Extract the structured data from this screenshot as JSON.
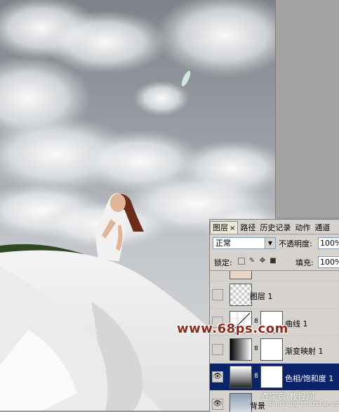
{
  "layers_panel": {
    "tabs": [
      {
        "label": "图层",
        "active": true
      },
      {
        "label": "路径",
        "active": false
      },
      {
        "label": "历史记录",
        "active": false
      },
      {
        "label": "动作",
        "active": false
      },
      {
        "label": "通道",
        "active": false
      }
    ],
    "blend_mode": "正常",
    "opacity_label": "不透明度:",
    "opacity_value": "100%",
    "lock_label": "锁定:",
    "fill_label": "填充:",
    "fill_value": "100%",
    "layers": [
      {
        "name": "图层 1",
        "visible": false,
        "selected": false,
        "icon": "checker-thumb"
      },
      {
        "name": "曲线 1",
        "visible": false,
        "selected": false,
        "icon": "curves-thumb"
      },
      {
        "name": "渐变映射 1",
        "visible": false,
        "selected": false,
        "icon": "gradient-map-thumb"
      },
      {
        "name": "色相/饱和度 1",
        "visible": true,
        "selected": true,
        "icon": "hue-saturation-thumb"
      },
      {
        "name": "背景",
        "visible": true,
        "selected": false,
        "icon": "background-thumb"
      }
    ]
  },
  "watermarks": {
    "site": "www.68ps.com",
    "cn_site": "查字典 教程网",
    "cn_url": "jiaocheng.chazidian.com"
  },
  "colors": {
    "selection": "#0a246a",
    "panel_bg": "#d6d3ce",
    "watermark": "#8b2c1c"
  }
}
